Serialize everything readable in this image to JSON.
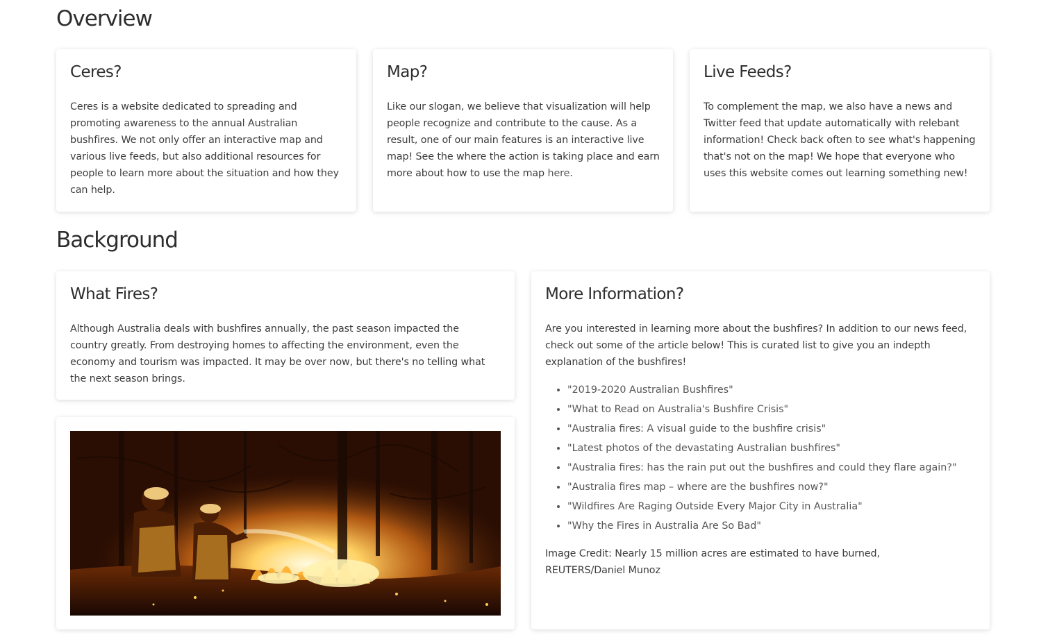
{
  "overview": {
    "heading": "Overview",
    "cards": [
      {
        "title": "Ceres?",
        "body": "Ceres is a website dedicated to spreading and promoting awareness to the annual Australian bushfires. We not only offer an interactive map and various live feeds, but also additional resources for people to learn more about the situation and how they can help."
      },
      {
        "title": "Map?",
        "body": "Like our slogan, we believe that visualization will help people recognize and contribute to the cause. As a result, one of our main features is an interactive live map! See the where the action is taking place and earn more about how to use the map ",
        "link_text": "here",
        "body_end": "."
      },
      {
        "title": "Live Feeds?",
        "body": "To complement the map, we also have a news and Twitter feed that update automatically with relebant information! Check back often to see what's happening that's not on the map! We hope that everyone who uses this website comes out learning something new!"
      }
    ]
  },
  "background": {
    "heading": "Background",
    "what_fires": {
      "title": "What Fires?",
      "body": "Although Australia deals with bushfires annually, the past season impacted the country greatly. From destroying homes to affecting the environment, even the economy and tourism was impacted. It may be over now, but there's no telling what the next season brings."
    },
    "more_info": {
      "title": "More Information?",
      "intro": "Are you interested in learning more about the bushfires? In addition to our news feed, check out some of the article below! This is curated list to give you an indepth explanation of the bushfires!",
      "links": [
        "\"2019-2020 Australian Bushfires\"",
        "\"What to Read on Australia's Bushfire Crisis\"",
        "\"Australia fires: A visual guide to the bushfire crisis\"",
        "\"Latest photos of the devastating Australian bushfires\"",
        "\"Australia fires: has the rain put out the bushfires and could they flare again?\"",
        "\"Australia fires map – where are the bushfires now?\"",
        "\"Wildfires Are Raging Outside Every Major City in Australia\"",
        "\"Why the Fires in Australia Are So Bad\""
      ],
      "credit": "Image Credit: Nearly 15 million acres are estimated to have burned, REUTERS/Daniel Munoz"
    }
  }
}
